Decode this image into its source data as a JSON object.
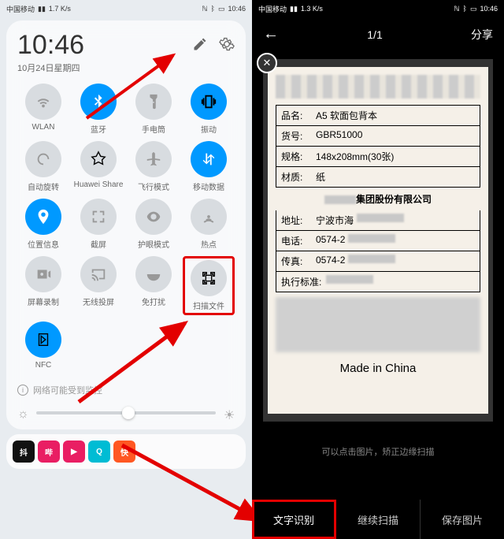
{
  "left": {
    "status": {
      "carrier1": "中国移动",
      "carrier2": "中国移动",
      "speed": "1.7 K/s",
      "time": "10:46",
      "nfc": "NFC",
      "bt": "BT",
      "battery": "84"
    },
    "time": "10:46",
    "date": "10月24日星期四",
    "tiles": [
      {
        "id": "wlan",
        "label": "WLAN",
        "active": false
      },
      {
        "id": "bluetooth",
        "label": "蓝牙",
        "active": true
      },
      {
        "id": "flashlight",
        "label": "手电筒",
        "active": false
      },
      {
        "id": "vibrate",
        "label": "振动",
        "active": true
      },
      {
        "id": "autorotate",
        "label": "自动旋转",
        "active": false
      },
      {
        "id": "huaweishare",
        "label": "Huawei Share",
        "active": false
      },
      {
        "id": "airplane",
        "label": "飞行模式",
        "active": false
      },
      {
        "id": "mobiledata",
        "label": "移动数据",
        "active": true
      },
      {
        "id": "location",
        "label": "位置信息",
        "active": true
      },
      {
        "id": "screenshot",
        "label": "截屏",
        "active": false
      },
      {
        "id": "eyecare",
        "label": "护眼模式",
        "active": false
      },
      {
        "id": "hotspot",
        "label": "热点",
        "active": false
      },
      {
        "id": "screenrec",
        "label": "屏幕录制",
        "active": false
      },
      {
        "id": "cast",
        "label": "无线投屏",
        "active": false
      },
      {
        "id": "dnd",
        "label": "免打扰",
        "active": false
      },
      {
        "id": "scandoc",
        "label": "扫描文件",
        "active": false,
        "highlight": true
      },
      {
        "id": "nfc",
        "label": "NFC",
        "active": true
      }
    ],
    "info": "网络可能受到监控",
    "dock": [
      "抖",
      "哔",
      "▶",
      "Q",
      "快"
    ]
  },
  "right": {
    "status": {
      "carrier1": "中国移动",
      "carrier2": "中国移动",
      "speed": "1.3 K/s",
      "time": "10:46",
      "battery": "84"
    },
    "counter": "1/1",
    "share": "分享",
    "doc": {
      "rows": [
        {
          "k": "品名:",
          "v": "A5 软面包背本"
        },
        {
          "k": "货号:",
          "v": "GBR51000"
        },
        {
          "k": "规格:",
          "v": "148x208mm(30张)"
        },
        {
          "k": "材质:",
          "v": "纸"
        }
      ],
      "company_suffix": "集团股份有限公司",
      "contact": [
        {
          "k": "地址:",
          "v": "宁波市海"
        },
        {
          "k": "电话:",
          "v": "0574-2"
        },
        {
          "k": "传真:",
          "v": "0574-2"
        }
      ],
      "std_label": "执行标准:",
      "made": "Made in China"
    },
    "hint": "可以点击图片，矫正边缘扫描",
    "buttons": [
      "文字识别",
      "继续扫描",
      "保存图片"
    ]
  }
}
